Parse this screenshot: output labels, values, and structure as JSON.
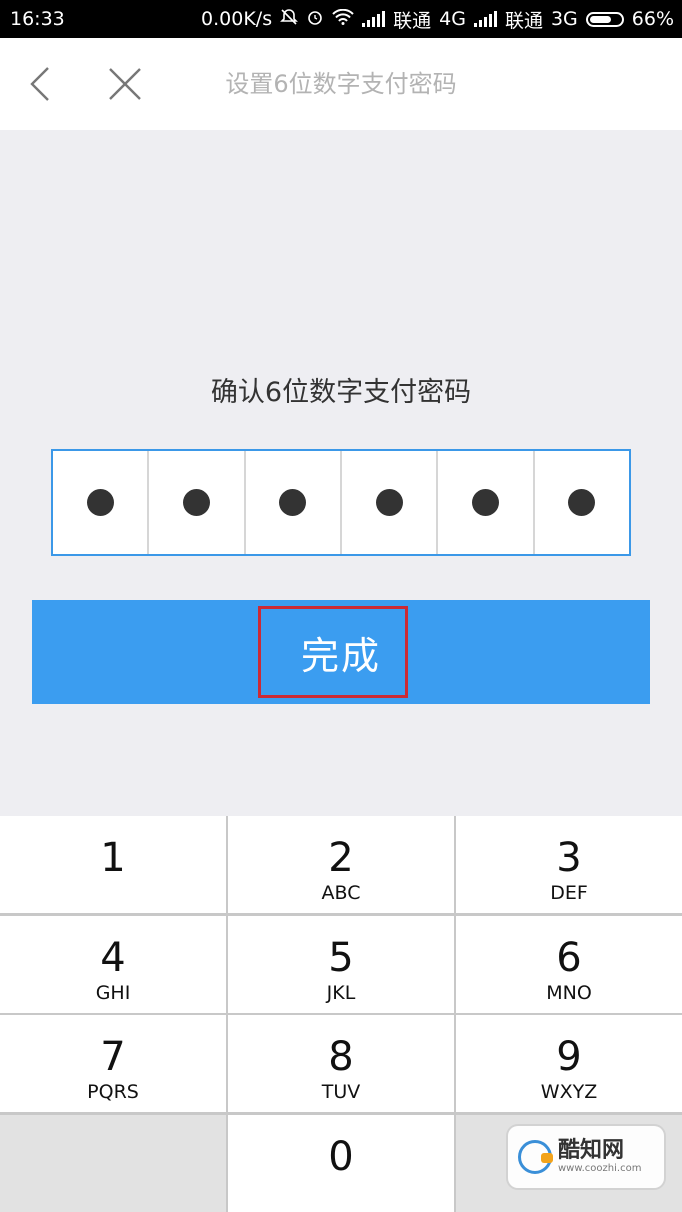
{
  "status_bar": {
    "time": "16:33",
    "speed": "0.00K/s",
    "carrier1": "联通",
    "net1": "4G",
    "carrier2": "联通",
    "net2": "3G",
    "battery": "66%"
  },
  "header": {
    "title": "设置6位数字支付密码",
    "back_icon": "chevron-left-icon",
    "close_icon": "close-icon"
  },
  "main": {
    "prompt": "确认6位数字支付密码",
    "pin_length": 6,
    "pin_filled": 6,
    "done_label": "完成"
  },
  "keypad": {
    "keys": [
      {
        "num": "1",
        "letters": ""
      },
      {
        "num": "2",
        "letters": "ABC"
      },
      {
        "num": "3",
        "letters": "DEF"
      },
      {
        "num": "4",
        "letters": "GHI"
      },
      {
        "num": "5",
        "letters": "JKL"
      },
      {
        "num": "6",
        "letters": "MNO"
      },
      {
        "num": "7",
        "letters": "PQRS"
      },
      {
        "num": "8",
        "letters": "TUV"
      },
      {
        "num": "9",
        "letters": "WXYZ"
      },
      {
        "num": "",
        "letters": ""
      },
      {
        "num": "0",
        "letters": ""
      },
      {
        "num": "",
        "letters": ""
      }
    ]
  },
  "watermark": {
    "name": "酷知网",
    "url": "www.coozhi.com"
  },
  "colors": {
    "accent": "#3b9df0",
    "highlight": "#cc2a35"
  }
}
